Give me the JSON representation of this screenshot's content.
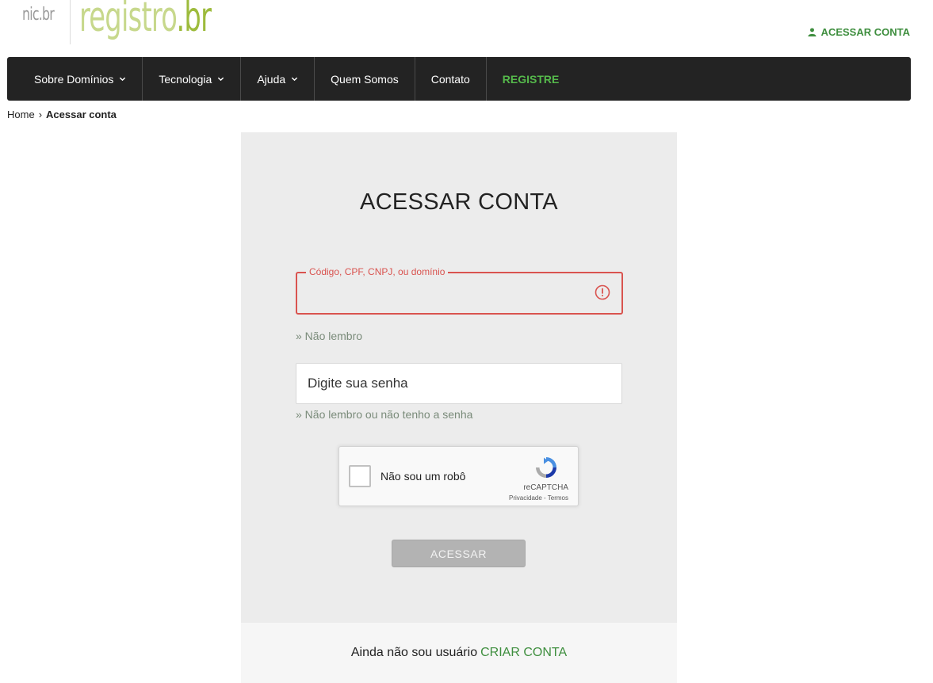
{
  "header": {
    "logo_nic": "nic.br",
    "logo_registro": "registro",
    "logo_br": ".br",
    "account_label": "ACESSAR CONTA"
  },
  "nav": {
    "items": [
      {
        "label": "Sobre Domínios",
        "dropdown": true
      },
      {
        "label": "Tecnologia",
        "dropdown": true
      },
      {
        "label": "Ajuda",
        "dropdown": true
      },
      {
        "label": "Quem Somos",
        "dropdown": false
      },
      {
        "label": "Contato",
        "dropdown": false
      },
      {
        "label": "REGISTRE",
        "dropdown": false
      }
    ]
  },
  "breadcrumb": {
    "home": "Home",
    "separator": "›",
    "current": "Acessar conta"
  },
  "login": {
    "title": "ACESSAR CONTA",
    "user_field_label": "Código, CPF, CNPJ, ou domínio",
    "user_field_value": "",
    "forgot_user": "» Não lembro",
    "password_placeholder": "Digite sua senha",
    "forgot_password": "» Não lembro ou não tenho a senha",
    "recaptcha": {
      "label": "Não sou um robô",
      "brand": "reCAPTCHA",
      "terms": "Privacidade - Termos"
    },
    "submit_label": "ACESSAR"
  },
  "signup": {
    "text": "Ainda não sou usuário",
    "link": "CRIAR CONTA"
  },
  "colors": {
    "accent_green": "#3e8e3e",
    "error_red": "#d9534f",
    "nav_bg": "#232323",
    "register_green": "#55b94b"
  }
}
